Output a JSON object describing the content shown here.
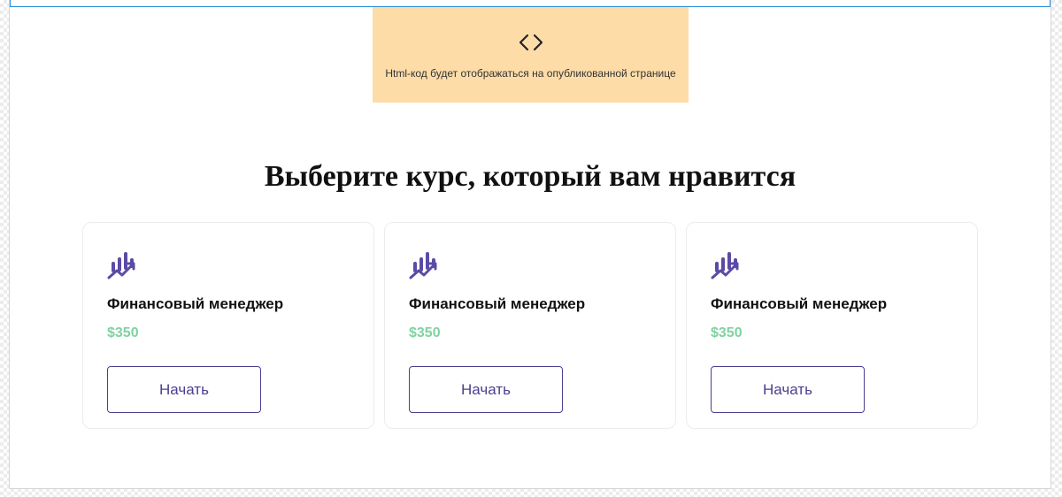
{
  "embed": {
    "icon": "code-brackets-icon",
    "note": "Html-код будет отображаться на опубликованной странице",
    "background": "#fddca8"
  },
  "heading": "Выберите курс, который вам нравится",
  "colors": {
    "accent": "#4d3f8f",
    "icon": "#5b4ba6",
    "price": "#7ed3a0",
    "selection_outline": "#2a8fd8"
  },
  "cards": [
    {
      "icon": "chart-growth-icon",
      "title": "Финансовый менеджер",
      "price": "$350",
      "button": "Начать"
    },
    {
      "icon": "chart-growth-icon",
      "title": "Финансовый менеджер",
      "price": "$350",
      "button": "Начать"
    },
    {
      "icon": "chart-growth-icon",
      "title": "Финансовый менеджер",
      "price": "$350",
      "button": "Начать"
    }
  ]
}
